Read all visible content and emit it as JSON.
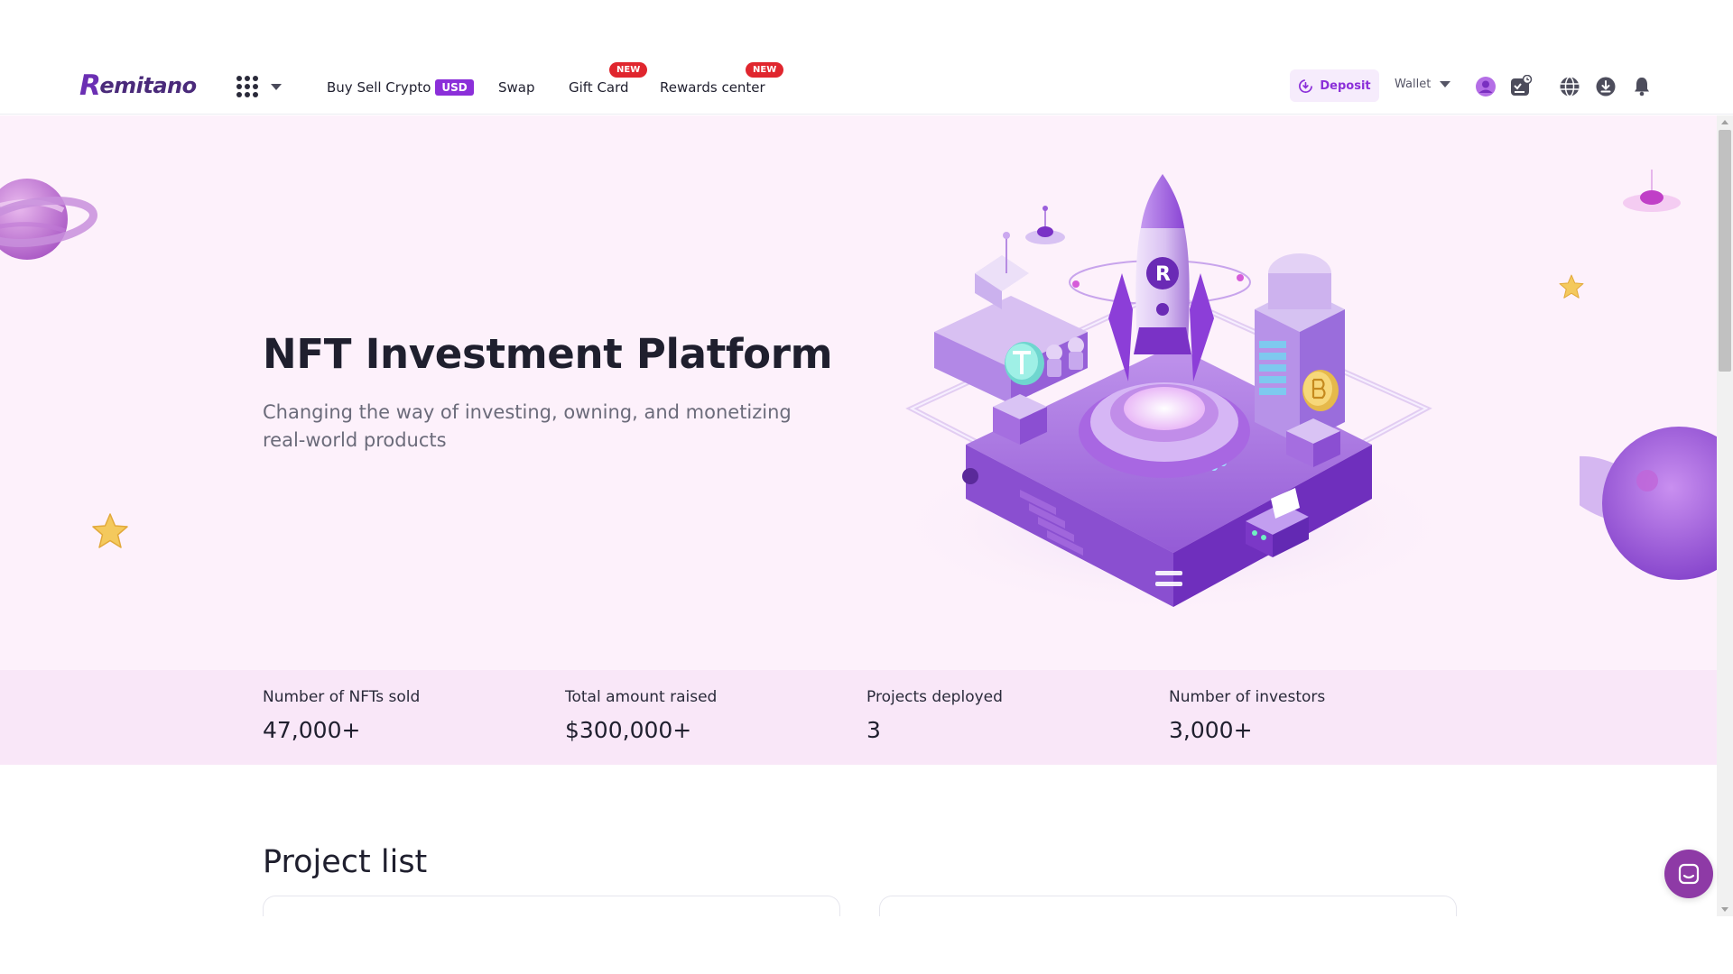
{
  "header": {
    "logo_text": "emitano",
    "logo_mark": "R",
    "nav": {
      "buy_sell": "Buy Sell Crypto",
      "usd_badge": "USD",
      "swap": "Swap",
      "gift_card": "Gift Card",
      "gift_card_badge": "NEW",
      "rewards": "Rewards center",
      "rewards_badge": "NEW"
    },
    "deposit_label": "Deposit",
    "wallet_label": "Wallet",
    "icons": [
      "apps-grid-icon",
      "deposit-icon",
      "avatar-icon",
      "task-icon",
      "globe-icon",
      "download-icon",
      "bell-icon"
    ]
  },
  "hero": {
    "title": "NFT Investment Platform",
    "subtitle": "Changing the way of investing, owning, and monetizing real-world products"
  },
  "stats": [
    {
      "label": "Number of NFTs sold",
      "value": "47,000+"
    },
    {
      "label": "Total amount raised",
      "value": "$300,000+"
    },
    {
      "label": "Projects deployed",
      "value": "3"
    },
    {
      "label": "Number of investors",
      "value": "3,000+"
    }
  ],
  "projects": {
    "title": "Project list"
  },
  "colors": {
    "brand_purple": "#8b2fd9",
    "logo_purple": "#4a2a7a",
    "hero_bg": "#fdf1fb",
    "stats_bg": "#f9e7f8",
    "badge_red": "#e0262e",
    "chat_purple": "#8e3aa6"
  }
}
